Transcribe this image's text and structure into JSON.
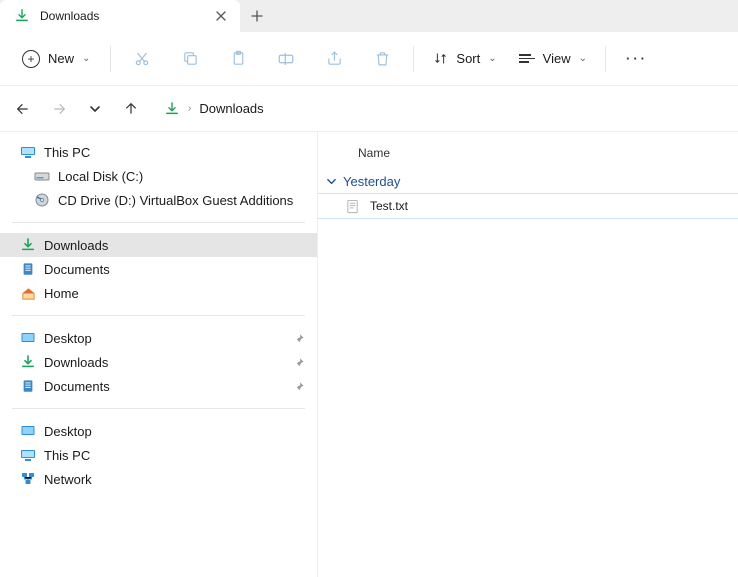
{
  "tab": {
    "title": "Downloads"
  },
  "toolbar": {
    "new_label": "New",
    "sort_label": "Sort",
    "view_label": "View"
  },
  "breadcrumb": {
    "current": "Downloads"
  },
  "sidebar": {
    "this_pc": "This PC",
    "local_disk": "Local Disk (C:)",
    "cd_drive": "CD Drive (D:) VirtualBox Guest Additions",
    "downloads": "Downloads",
    "documents": "Documents",
    "home": "Home",
    "desktop": "Desktop",
    "downloads2": "Downloads",
    "documents2": "Documents",
    "desktop2": "Desktop",
    "this_pc2": "This PC",
    "network": "Network"
  },
  "content": {
    "column_name": "Name",
    "group_yesterday": "Yesterday",
    "files": [
      {
        "name": "Test.txt"
      }
    ]
  }
}
